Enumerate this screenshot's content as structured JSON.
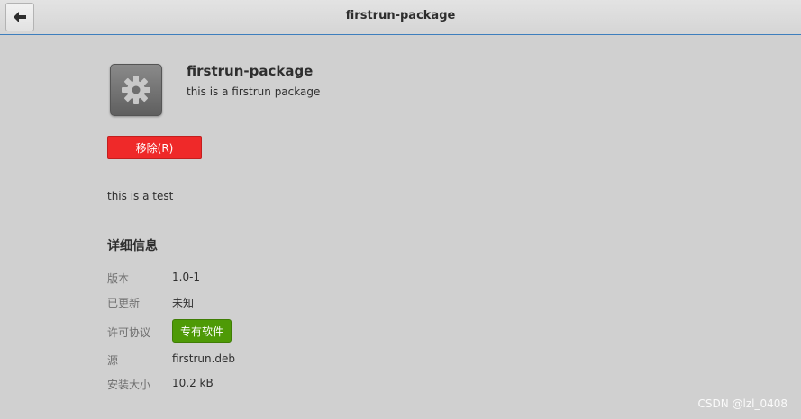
{
  "header": {
    "title": "firstrun-package"
  },
  "app": {
    "name": "firstrun-package",
    "summary": "this is a firstrun package",
    "icon": "gear-icon",
    "remove_label": "移除(R)",
    "description": "this is a test"
  },
  "details": {
    "heading": "详细信息",
    "rows": [
      {
        "label": "版本",
        "value": "1.0-1"
      },
      {
        "label": "已更新",
        "value": "未知"
      },
      {
        "label": "许可协议",
        "value": "专有软件"
      },
      {
        "label": "源",
        "value": "firstrun.deb"
      },
      {
        "label": "安装大小",
        "value": "10.2 kB"
      }
    ]
  },
  "watermark": "CSDN @lzl_0408",
  "colors": {
    "remove_button": "#ef2929",
    "license_badge": "#4e9a06",
    "header_border": "#3d7ebd"
  }
}
